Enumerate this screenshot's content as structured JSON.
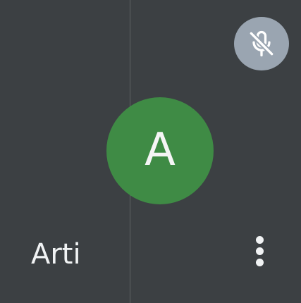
{
  "participant": {
    "name": "Arti",
    "initial": "A",
    "avatar_color": "#3f8b45",
    "mic_state": "muted"
  },
  "icons": {
    "mute_indicator": "mic-off-icon",
    "more_options": "more-vert-icon"
  },
  "colors": {
    "tile_background": "#3c4043",
    "mute_badge": "#9aa5b1",
    "text": "#f1f3f4"
  }
}
